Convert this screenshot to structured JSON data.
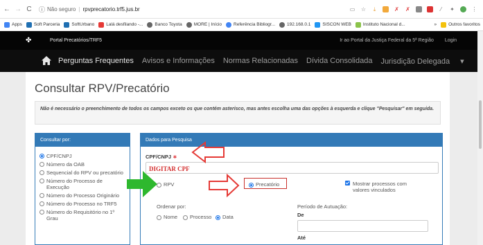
{
  "browser": {
    "address": {
      "info_icon": "info-icon",
      "security_label": "Não seguro",
      "url": "rpvprecatorio.trf5.jus.br"
    },
    "bookmarks": [
      {
        "label": "Apps",
        "color": "#4285f4"
      },
      {
        "label": "Soft Parceria",
        "color": "#1f6fb2"
      },
      {
        "label": "SoftUrbano",
        "color": "#1f6fb2"
      },
      {
        "label": "Lalá desfilando -...",
        "color": "#e53935"
      },
      {
        "label": "Banco Toyota",
        "color": "#666666"
      },
      {
        "label": "MORE | Início",
        "color": "#666666"
      },
      {
        "label": "Referência Bibliogr...",
        "color": "#4285f4"
      },
      {
        "label": "192.168.0.1",
        "color": "#666666"
      },
      {
        "label": "SISCON WEB",
        "color": "#2196f3"
      },
      {
        "label": "Instituto Nacional d...",
        "color": "#8bc34a"
      }
    ],
    "bookmarks_more": "»",
    "other_bookmarks": "Outros favoritos"
  },
  "portal": {
    "title": "Portal Precatórios/TRF5",
    "top_links": [
      "Ir ao Portal da Justiça Federal da 5ª Região",
      "Login"
    ],
    "menu": [
      "Perguntas Frequentes",
      "Avisos e Informações",
      "Normas Relacionadas",
      "Dívida Consolidada",
      "Jurisdição Delegada"
    ],
    "menu_dropdown_suffix": " ▾"
  },
  "page": {
    "title": "Consultar RPV/Precatório",
    "info": "Não é necessário o preenchimento de todos os campos exceto os que contém asterisco, mas antes escolha uma das opções à esquerda e clique \"Pesquisar\" em seguida."
  },
  "left_panel": {
    "header": "Consultar por:",
    "options": [
      {
        "label": "CPF/CNPJ",
        "selected": true
      },
      {
        "label": "Número da OAB",
        "selected": false
      },
      {
        "label": "Sequencial do RPV ou precatório",
        "selected": false
      },
      {
        "label": "Número do Processo de Execução",
        "selected": false
      },
      {
        "label": "Número do Processo Originário",
        "selected": false
      },
      {
        "label": "Número do Processo no TRF5",
        "selected": false
      },
      {
        "label": "Número do Requisitório no 1º Grau",
        "selected": false
      }
    ]
  },
  "right_panel": {
    "header": "Dados para Pesquisa",
    "cpf_label": "CPF/CNPJ",
    "required_mark": "∗",
    "cpf_value": "",
    "type_options": [
      {
        "label": "RPV",
        "selected": false
      },
      {
        "label": "Precatório",
        "selected": true
      }
    ],
    "show_values_label": "Mostrar processos com valores vinculados",
    "show_values_checked": true,
    "order_label": "Ordenar por:",
    "order_options": [
      {
        "label": "Nome",
        "selected": false
      },
      {
        "label": "Processo",
        "selected": false
      },
      {
        "label": "Data",
        "selected": true
      }
    ],
    "period_label": "Período de Autuação:",
    "from_label": "De",
    "from_value": "",
    "to_label": "Até"
  },
  "annotation": {
    "text": "DIGITAR CPF",
    "color": "#d42f2f",
    "arrow_color": "#e53935",
    "green_arrow_color": "#2eb82e"
  }
}
